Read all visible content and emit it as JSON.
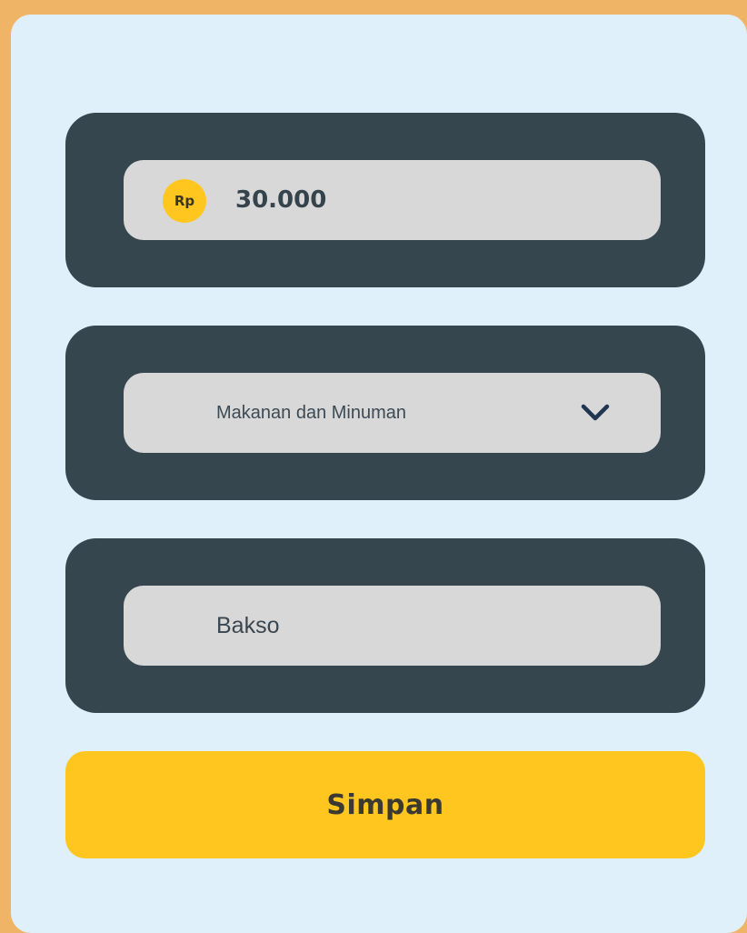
{
  "form": {
    "amount": {
      "currency_badge": "Rp",
      "value": "30.000"
    },
    "category": {
      "selected": "Makanan dan Minuman",
      "icon": "chevron-down-icon"
    },
    "description": {
      "value": "Bakso"
    },
    "submit_label": "Simpan"
  },
  "colors": {
    "page_background": "#F0B467",
    "card_background": "#DFF0FA",
    "panel": "#36464F",
    "field": "#D8D8D8",
    "accent": "#FFC61F"
  }
}
